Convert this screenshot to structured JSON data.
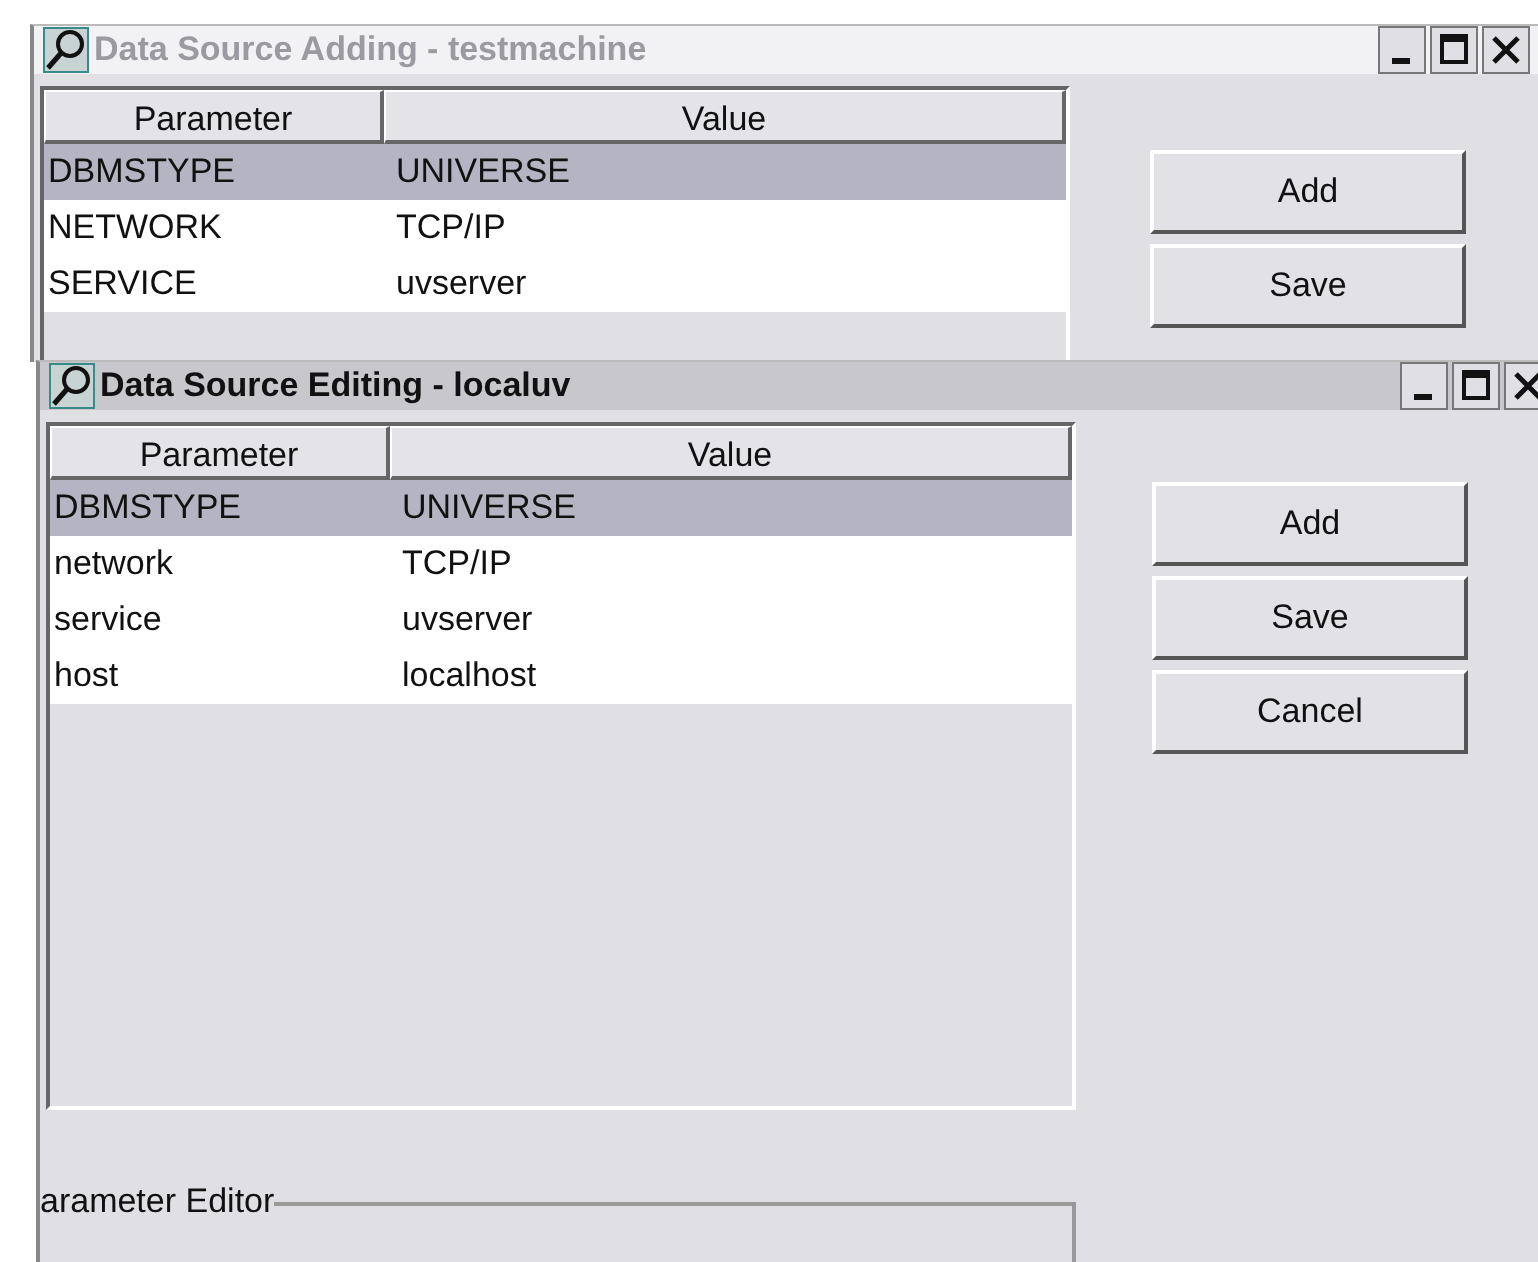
{
  "windows": [
    {
      "title": "Data Source Adding - testmachine",
      "active": false,
      "columns": [
        "Parameter",
        "Value"
      ],
      "rows": [
        {
          "cells": [
            "DBMSTYPE",
            "UNIVERSE"
          ],
          "selected": true
        },
        {
          "cells": [
            "NETWORK",
            "TCP/IP"
          ],
          "selected": false
        },
        {
          "cells": [
            "SERVICE",
            "uvserver"
          ],
          "selected": false
        }
      ],
      "buttons": [
        "Add",
        "Save"
      ]
    },
    {
      "title": "Data Source Editing - localuv",
      "active": true,
      "columns": [
        "Parameter",
        "Value"
      ],
      "rows": [
        {
          "cells": [
            "DBMSTYPE",
            "UNIVERSE"
          ],
          "selected": true
        },
        {
          "cells": [
            "network",
            "TCP/IP"
          ],
          "selected": false
        },
        {
          "cells": [
            "service",
            "uvserver"
          ],
          "selected": false
        },
        {
          "cells": [
            "host",
            "localhost"
          ],
          "selected": false
        }
      ],
      "buttons": [
        "Add",
        "Save",
        "Cancel"
      ],
      "group_label": "arameter Editor"
    }
  ]
}
